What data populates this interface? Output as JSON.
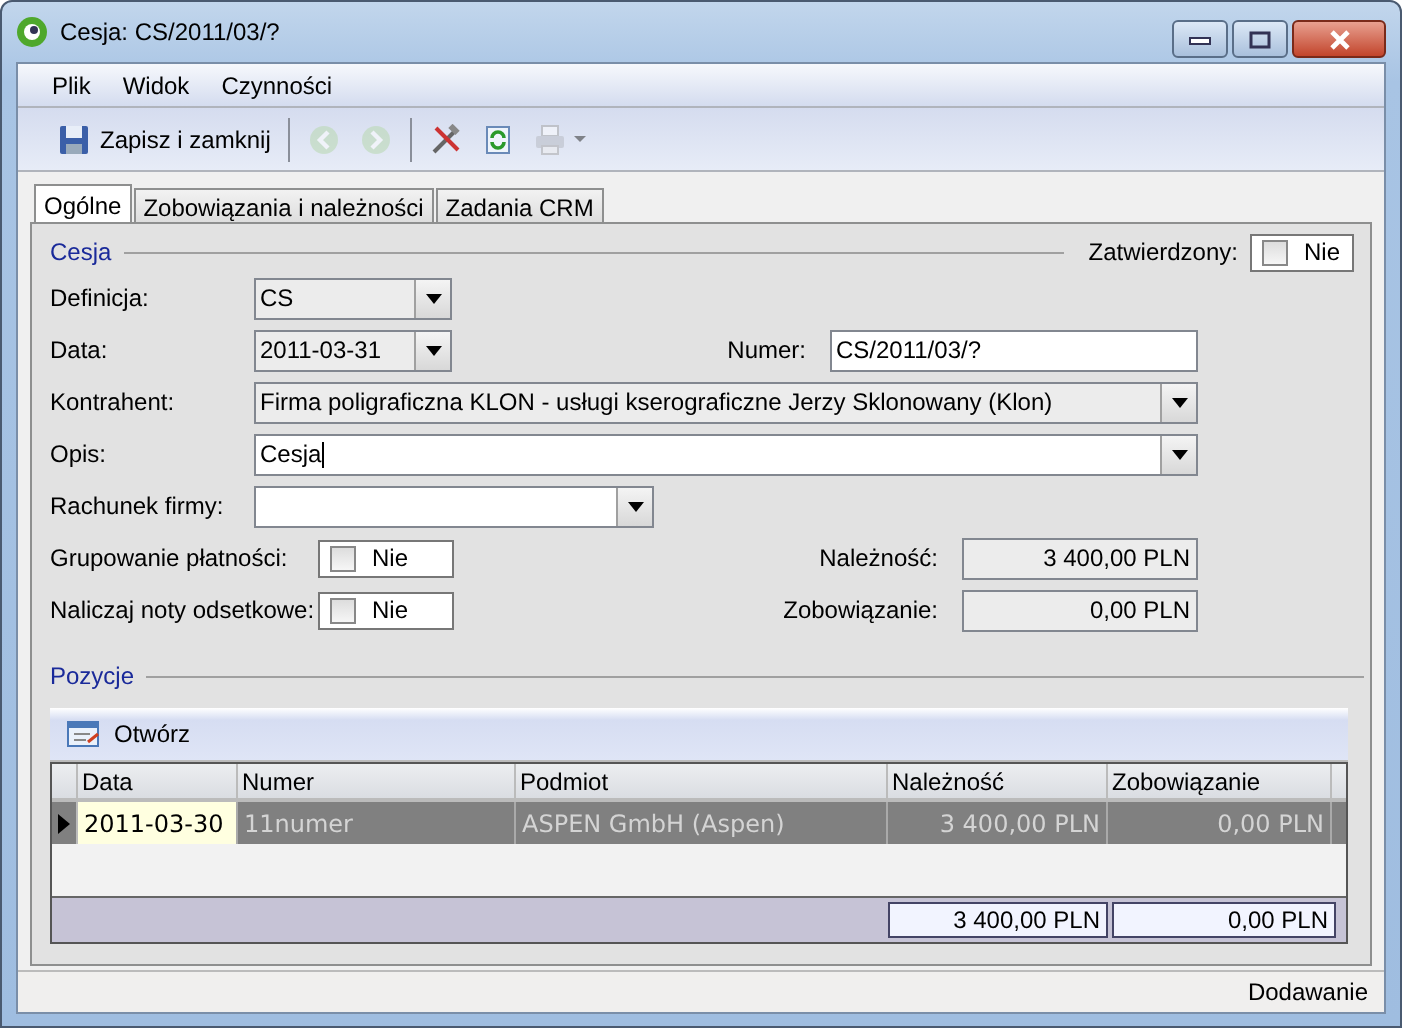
{
  "window": {
    "title": "Cesja: CS/2011/03/?"
  },
  "menu": [
    {
      "label": "Plik"
    },
    {
      "label": "Widok"
    },
    {
      "label": "Czynności"
    }
  ],
  "toolbar": [
    {
      "kind": "save",
      "label": "Zapisz i zamknij",
      "disabled": false
    },
    {
      "kind": "back",
      "disabled": true
    },
    {
      "kind": "forward",
      "disabled": true
    },
    {
      "kind": "tools",
      "disabled": false
    },
    {
      "kind": "refresh",
      "disabled": false
    },
    {
      "kind": "print",
      "disabled": true
    }
  ],
  "tabs": [
    {
      "label": "Ogólne",
      "selected": true
    },
    {
      "label": "Zobowiązania i należności",
      "selected": false
    },
    {
      "label": "Zadania CRM",
      "selected": false
    }
  ],
  "header": {
    "section": "Cesja",
    "approved": {
      "label": "Zatwierdzony:",
      "checked": false,
      "text": "Nie"
    }
  },
  "definicja": {
    "label": "Definicja:",
    "value": "CS",
    "readonly": true
  },
  "data": {
    "label": "Data:",
    "value": "2011-03-31",
    "readonly": true
  },
  "numer": {
    "label": "Numer:",
    "value": "CS/2011/03/?",
    "readonly": false
  },
  "kontrahent": {
    "label": "Kontrahent:",
    "value": "Firma poligraficzna KLON - usługi kserograficzne Jerzy Sklonowany (Klon)",
    "readonly": true
  },
  "opis": {
    "label": "Opis:",
    "value": "Cesja",
    "readonly": false,
    "focused": true
  },
  "rachunek": {
    "label": "Rachunek firmy:",
    "readonly": false
  },
  "grupowanie": {
    "label": "Grupowanie płatności:",
    "checked": false,
    "text": "Nie"
  },
  "noty": {
    "label": "Naliczaj noty odsetkowe:",
    "checked": false,
    "text": "Nie"
  },
  "naleznosc": {
    "label": "Należność:",
    "value": "3 400,00 PLN"
  },
  "zobowiazanie": {
    "label": "Zobowiązanie:",
    "value": "0,00 PLN"
  },
  "positions": {
    "section": "Pozycje",
    "open_button": "Otwórz",
    "columns": [
      "Data",
      "Numer",
      "Podmiot",
      "Należność",
      "Zobowiązanie"
    ],
    "rows": [
      {
        "selected": true,
        "cells": [
          "2011-03-30",
          "11numer",
          "ASPEN GmbH (Aspen)",
          "3 400,00 PLN",
          "0,00 PLN"
        ]
      }
    ],
    "totals": [
      "3 400,00 PLN",
      "0,00 PLN"
    ]
  },
  "status_bar": "Dodawanie"
}
